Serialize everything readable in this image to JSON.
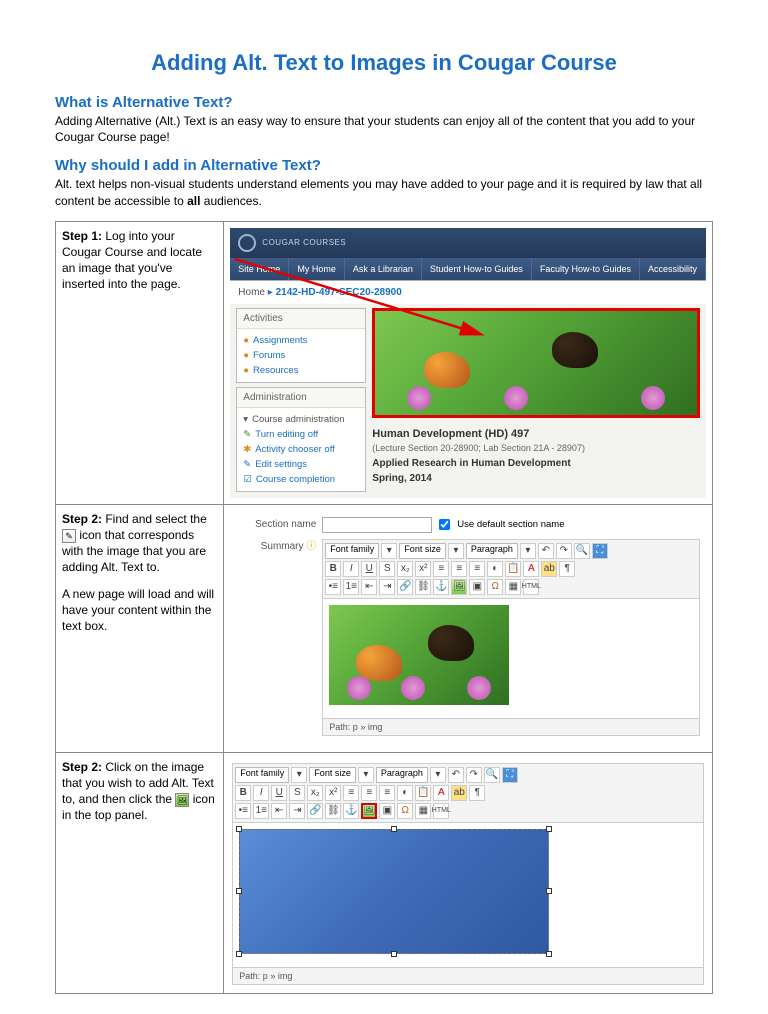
{
  "title": "Adding Alt. Text to Images in Cougar Course",
  "sections": {
    "what": {
      "heading": "What is Alternative Text?",
      "body": "Adding Alternative (Alt.) Text is an easy way to ensure that your students can enjoy all of the content that you add to your Cougar Course page!"
    },
    "why": {
      "heading": "Why should I add in Alternative Text?",
      "body_pre": "Alt. text helps non-visual students understand elements you may have added to your page and it is required by law that all content be accessible to ",
      "body_bold": "all",
      "body_post": " audiences."
    }
  },
  "steps": [
    {
      "label": "Step 1:",
      "text": " Log into your Cougar Course and locate an image that you've inserted into the page."
    },
    {
      "label": "Step 2:",
      "text_a": " Find and select the ",
      "text_b": " icon that corresponds with the image that you are adding Alt. Text to.",
      "para2": "A new page will load and will have your content within the text box."
    },
    {
      "label": "Step 2:",
      "text_a": " Click on the image that you wish to add Alt. Text to, and then click the ",
      "text_b": " icon in the top panel."
    }
  ],
  "screenshot1": {
    "logo_label": "COUGAR COURSES",
    "nav": [
      "Site Home",
      "My Home",
      "Ask a Librarian",
      "Student How-to Guides",
      "Faculty How-to Guides",
      "Accessibility"
    ],
    "breadcrumb_home": "Home",
    "breadcrumb_course": "2142-HD-497-SEC20-28900",
    "panel_activities": "Activities",
    "links_activities": [
      "Assignments",
      "Forums",
      "Resources"
    ],
    "panel_admin": "Administration",
    "admin_heading": "Course administration",
    "links_admin": [
      "Turn editing off",
      "Activity chooser off",
      "Edit settings",
      "Course completion"
    ],
    "course_title": "Human Development (HD) 497",
    "course_sub": "(Lecture Section 20-28900; Lab Section 21A - 28907)",
    "course_desc": "Applied Research in Human Development",
    "course_term": "Spring, 2014"
  },
  "screenshot2": {
    "section_name_label": "Section name",
    "summary_label": "Summary",
    "use_default": "Use default section name",
    "font_family": "Font family",
    "font_size": "Font size",
    "paragraph": "Paragraph",
    "path": "Path: p » img"
  },
  "screenshot3": {
    "font_family": "Font family",
    "font_size": "Font size",
    "paragraph": "Paragraph",
    "path": "Path: p » img"
  }
}
